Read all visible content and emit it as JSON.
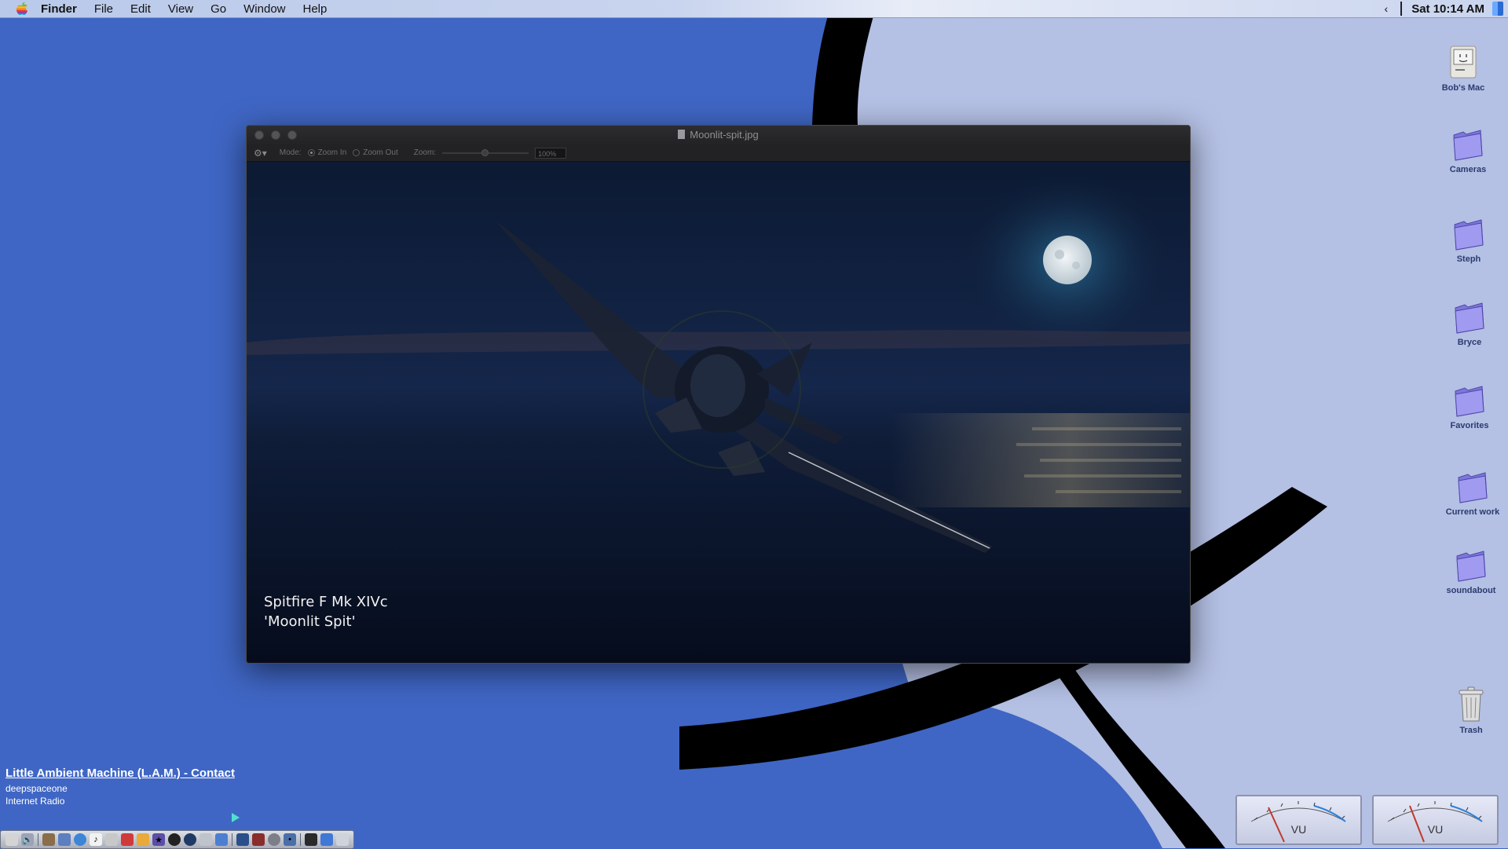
{
  "menubar": {
    "app_name": "Finder",
    "items": [
      "File",
      "Edit",
      "View",
      "Go",
      "Window",
      "Help"
    ],
    "clock": "Sat 10:14 AM",
    "chevron": "‹"
  },
  "desktop_icons": [
    {
      "label": "Bob's Mac",
      "icon": "computer-icon"
    },
    {
      "label": "Cameras",
      "icon": "folder-icon"
    },
    {
      "label": "Steph",
      "icon": "folder-icon"
    },
    {
      "label": "Bryce",
      "icon": "folder-icon"
    },
    {
      "label": "Favorites",
      "icon": "folder-icon"
    },
    {
      "label": "Current work",
      "icon": "folder-icon"
    },
    {
      "label": "soundabout",
      "icon": "folder-icon"
    },
    {
      "label": "Trash",
      "icon": "trash-icon"
    }
  ],
  "window": {
    "title": "Moonlit-spit.jpg",
    "toolbar": {
      "mode_label": "Mode:",
      "zoom_in_label": "Zoom In",
      "zoom_out_label": "Zoom Out",
      "zoom_label": "Zoom:",
      "zoom_value": "100%",
      "selected_mode": "Zoom In"
    },
    "caption_line1": "Spitfire F Mk XIVc",
    "caption_line2": "'Moonlit Spit'"
  },
  "radio": {
    "title": "Little Ambient Machine (L.A.M.) - Contact",
    "station": "deepspaceone",
    "source": "Internet Radio"
  },
  "vu_meters": [
    {
      "label": "VU"
    },
    {
      "label": "VU"
    }
  ],
  "colors": {
    "desktop_blue": "#3f66c4",
    "desktop_light": "#b4c0e4",
    "window_dark": "#1d1d1f",
    "folder": "#8c86e6",
    "play_accent": "#4fe0cf"
  }
}
